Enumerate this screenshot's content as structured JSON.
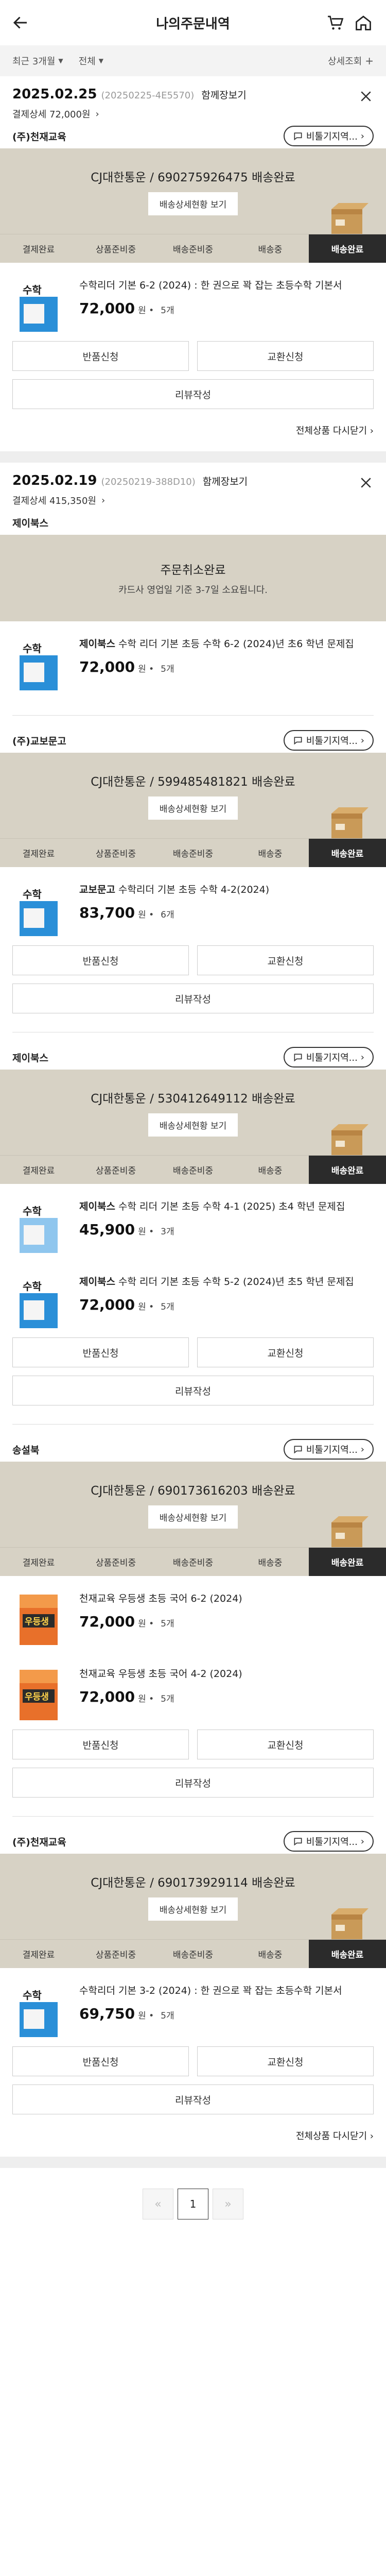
{
  "header": {
    "title": "나의주문내역"
  },
  "filters": {
    "period": "최근 3개월",
    "type": "전체",
    "detail": "상세조회"
  },
  "steps": [
    "결제완료",
    "상품준비중",
    "배송준비중",
    "배송중",
    "배송완료"
  ],
  "common": {
    "together": "함께장보기",
    "track_btn": "배송상세현황 보기",
    "contact": "비툴기지역...",
    "return_btn": "반품신청",
    "exchange_btn": "교환신청",
    "review_btn": "리뷰작성",
    "collapse": "전체상품 다시닫기",
    "unit_suffix": "원 •"
  },
  "orders": [
    {
      "date": "2025.02.25",
      "order_no": "(20250225-4E5570)",
      "pay": "결제상세 72,000원",
      "groups": [
        {
          "seller": "(주)천재교육",
          "courier": "CJ대한통운 / 690275926475 배송완료",
          "items": [
            {
              "name": "수학리더 기본 6-2 (2024) : 한 권으로 꽉 잡는 초등수학 기본서",
              "price": "72,000",
              "qty": "5개"
            }
          ]
        }
      ]
    },
    {
      "date": "2025.02.19",
      "order_no": "(20250219-388D10)",
      "pay": "결제상세 415,350원",
      "groups": [
        {
          "seller": "제이북스",
          "cancel_title": "주문취소완료",
          "cancel_sub": "카드사 영업일 기준 3-7일 소요됩니다.",
          "items": [
            {
              "brand": "제이북스",
              "name": "수학 리더 기본 초등 수학 6-2 (2024)년 초6 학년 문제집",
              "price": "72,000",
              "qty": "5개"
            }
          ]
        },
        {
          "seller": "(주)교보문고",
          "courier": "CJ대한통운 / 599485481821 배송완료",
          "items": [
            {
              "brand": "교보문고",
              "name": "수학리더 기본 초등 수학 4-2(2024)",
              "price": "83,700",
              "qty": "6개"
            }
          ]
        },
        {
          "seller": "제이북스",
          "courier": "CJ대한통운 / 530412649112 배송완료",
          "items": [
            {
              "brand": "제이북스",
              "name": "수학 리더 기본 초등 수학 4-1 (2025) 초4 학년 문제집",
              "price": "45,900",
              "qty": "3개"
            },
            {
              "brand": "제이북스",
              "name": "수학 리더 기본 초등 수학 5-2 (2024)년 초5 학년 문제집",
              "price": "72,000",
              "qty": "5개"
            }
          ]
        },
        {
          "seller": "송설북",
          "courier": "CJ대한통운 / 690173616203 배송완료",
          "items": [
            {
              "name": "천재교육 우등생 초등 국어 6-2 (2024)",
              "price": "72,000",
              "qty": "5개"
            },
            {
              "name": "천재교육 우등생 초등 국어 4-2 (2024)",
              "price": "72,000",
              "qty": "5개"
            }
          ]
        },
        {
          "seller": "(주)천재교육",
          "courier": "CJ대한통운 / 690173929114 배송완료",
          "items": [
            {
              "name": "수학리더 기본 3-2 (2024) : 한 권으로 꽉 잡는 초등수학 기본서",
              "price": "69,750",
              "qty": "5개"
            }
          ]
        }
      ]
    }
  ],
  "pagination": {
    "current": "1",
    "prev": "«",
    "next": "»"
  },
  "colors": {
    "banner": "#d7d2c5",
    "active_step": "#2b2b2b",
    "book_blue": "#2a8fd8",
    "book_orange": "#e8702a"
  },
  "icons": [
    "back-arrow-icon",
    "cart-icon",
    "home-icon",
    "close-icon",
    "chat-icon",
    "chevron-right-icon",
    "box-icon"
  ]
}
